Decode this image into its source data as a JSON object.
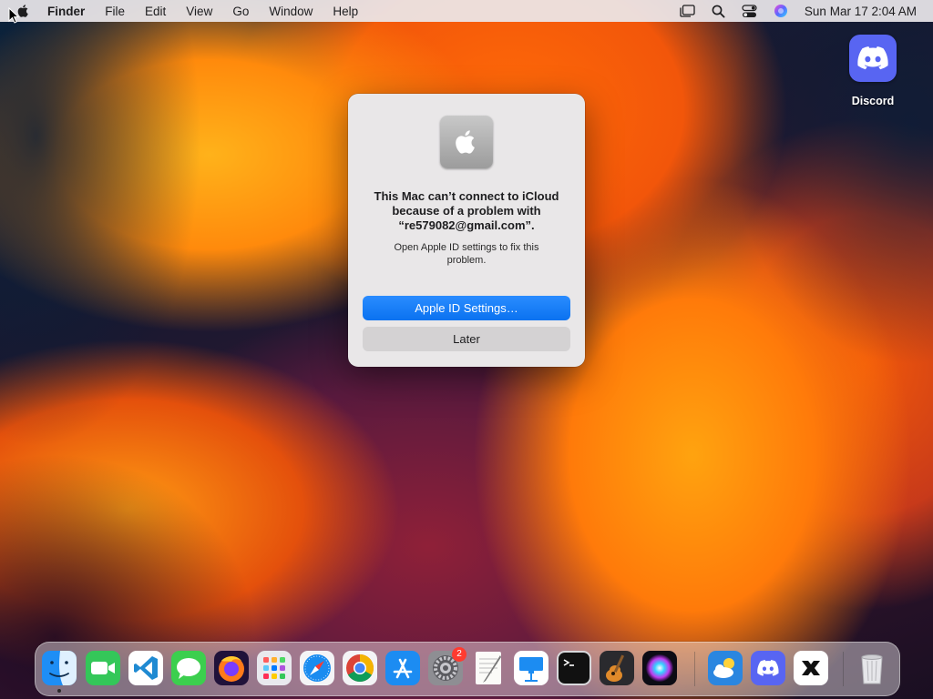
{
  "menubar": {
    "app_name": "Finder",
    "menus": [
      "File",
      "Edit",
      "View",
      "Go",
      "Window",
      "Help"
    ],
    "clock": "Sun Mar 17  2:04 AM",
    "status_icons": [
      "stage-manager-icon",
      "search-icon",
      "control-center-icon",
      "siri-icon"
    ]
  },
  "desktop": {
    "icons": [
      {
        "label": "Discord",
        "icon": "discord-icon"
      }
    ]
  },
  "dialog": {
    "icon": "apple-logo-icon",
    "message": "This Mac can’t connect to iCloud because of a problem with “re579082@gmail.com”.",
    "info": "Open Apple ID settings to fix this problem.",
    "primary_button": "Apple ID Settings…",
    "secondary_button": "Later"
  },
  "dock": {
    "apps": [
      {
        "name": "Finder",
        "icon": "finder-icon",
        "running": true
      },
      {
        "name": "FaceTime",
        "icon": "facetime-icon"
      },
      {
        "name": "Visual Studio Code",
        "icon": "vscode-icon"
      },
      {
        "name": "Messages",
        "icon": "messages-icon"
      },
      {
        "name": "Firefox",
        "icon": "firefox-icon"
      },
      {
        "name": "Launchpad",
        "icon": "launchpad-icon"
      },
      {
        "name": "Safari",
        "icon": "safari-icon"
      },
      {
        "name": "Google Chrome",
        "icon": "chrome-icon"
      },
      {
        "name": "App Store",
        "icon": "app-store-icon"
      },
      {
        "name": "System Preferences",
        "icon": "system-preferences-icon",
        "badge": "2"
      },
      {
        "name": "TextEdit",
        "icon": "textedit-icon"
      },
      {
        "name": "Keynote",
        "icon": "keynote-icon"
      },
      {
        "name": "Terminal",
        "icon": "terminal-icon"
      },
      {
        "name": "GarageBand",
        "icon": "garageband-icon"
      },
      {
        "name": "Siri",
        "icon": "siri-icon"
      },
      {
        "name": "Weather",
        "icon": "weather-icon"
      },
      {
        "name": "Discord",
        "icon": "discord-icon"
      },
      {
        "name": "CapCut",
        "icon": "capcut-icon"
      },
      {
        "name": "Trash",
        "icon": "trash-icon"
      }
    ]
  }
}
